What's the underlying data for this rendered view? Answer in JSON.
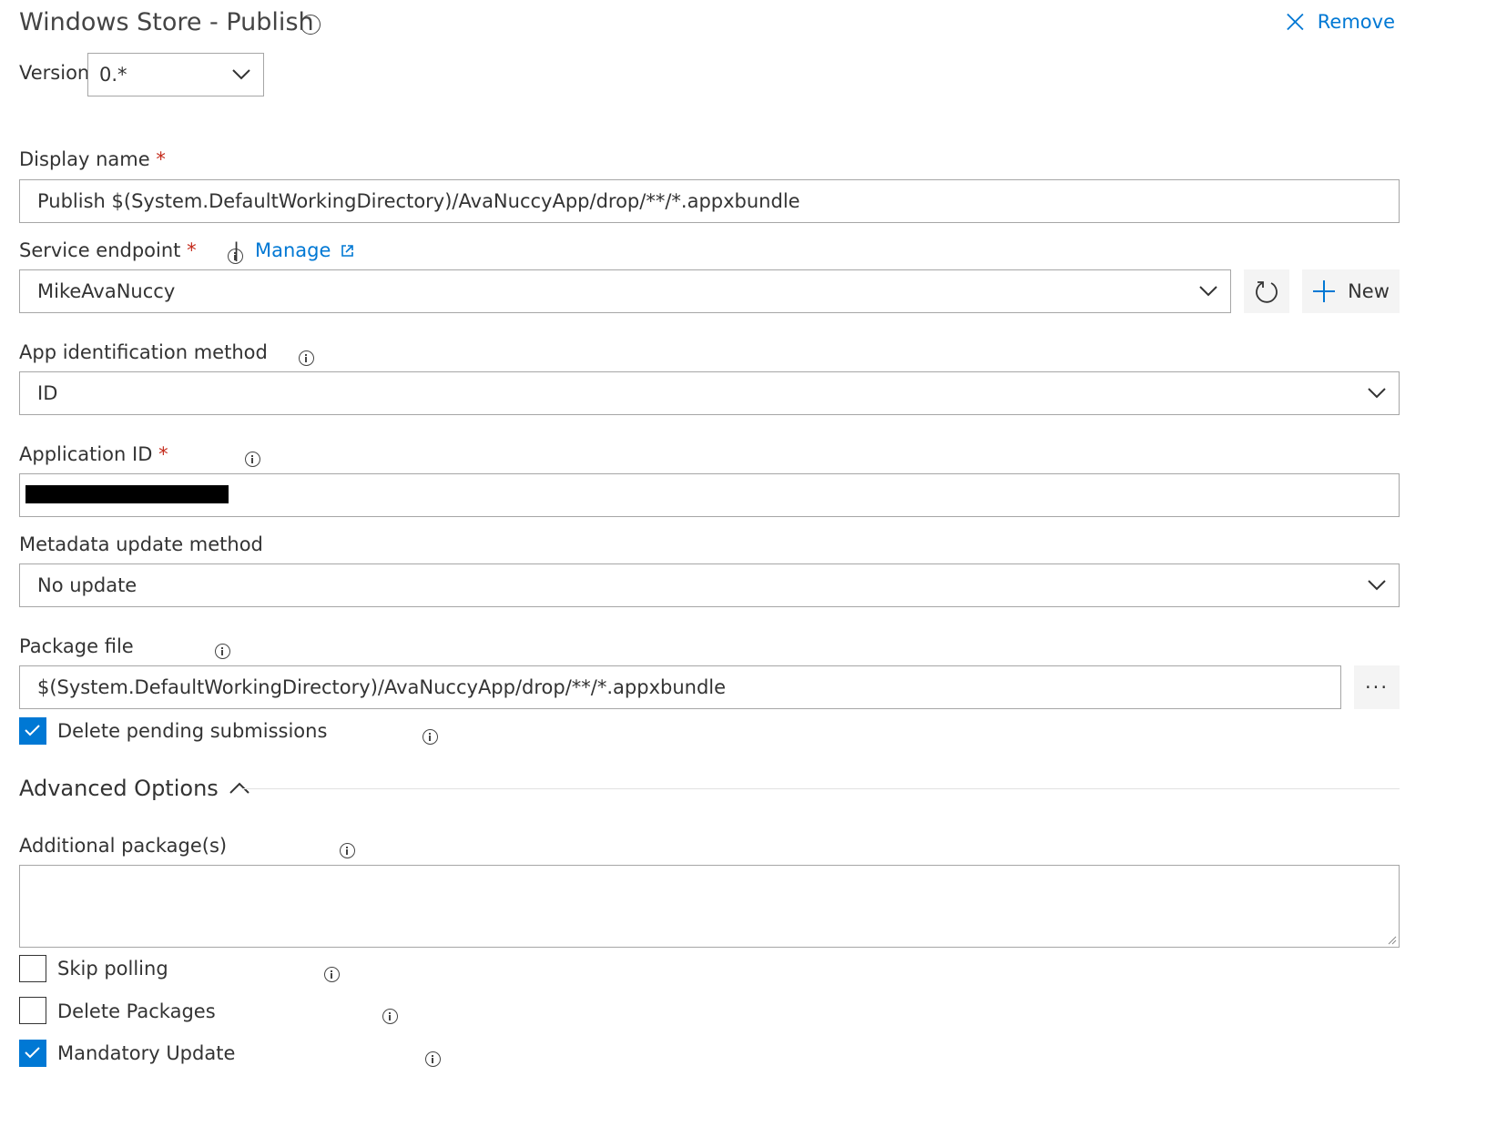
{
  "header": {
    "title": "Windows Store - Publish",
    "remove_label": "Remove"
  },
  "version": {
    "label": "Version",
    "value": "0.*"
  },
  "display_name": {
    "label": "Display name",
    "required_mark": "*",
    "value": "Publish $(System.DefaultWorkingDirectory)/AvaNuccyApp/drop/**/*.appxbundle"
  },
  "service_endpoint": {
    "label": "Service endpoint",
    "required_mark": "*",
    "separator": "|",
    "manage_label": "Manage",
    "value": "MikeAvaNuccy",
    "new_label": "New"
  },
  "app_identification": {
    "label": "App identification method",
    "value": "ID"
  },
  "application_id": {
    "label": "Application ID",
    "required_mark": "*"
  },
  "metadata_update": {
    "label": "Metadata update method",
    "value": "No update"
  },
  "package_file": {
    "label": "Package file",
    "value": "$(System.DefaultWorkingDirectory)/AvaNuccyApp/drop/**/*.appxbundle",
    "browse_label": "···"
  },
  "delete_pending": {
    "label": "Delete pending submissions",
    "checked": true
  },
  "advanced": {
    "label": "Advanced Options",
    "expanded": true
  },
  "additional_packages": {
    "label": "Additional package(s)",
    "value": ""
  },
  "skip_polling": {
    "label": "Skip polling",
    "checked": false
  },
  "delete_packages": {
    "label": "Delete Packages",
    "checked": false
  },
  "mandatory_update": {
    "label": "Mandatory Update",
    "checked": true
  },
  "colors": {
    "accent": "#0078d4",
    "required": "#c42b1c",
    "border": "#a6a6a6"
  }
}
